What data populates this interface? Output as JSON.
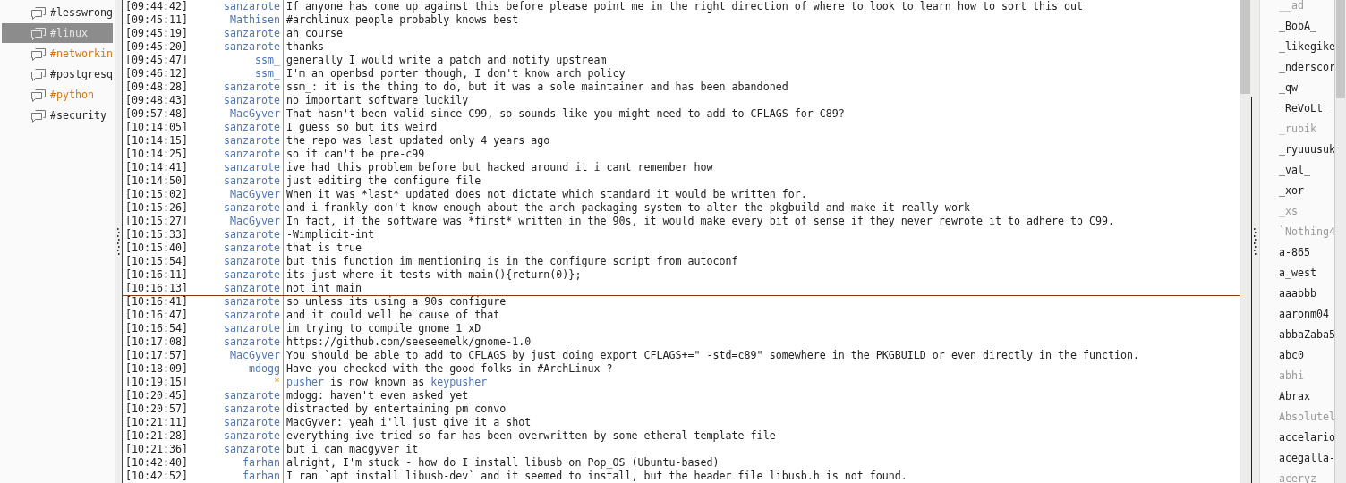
{
  "sidebar": [
    {
      "label": "#lesswrong",
      "selected": false,
      "activity": false
    },
    {
      "label": "#linux",
      "selected": true,
      "activity": false
    },
    {
      "label": "#networkin",
      "selected": false,
      "activity": true
    },
    {
      "label": "#postgresq",
      "selected": false,
      "activity": false
    },
    {
      "label": "#python",
      "selected": false,
      "activity": true
    },
    {
      "label": "#security",
      "selected": false,
      "activity": false
    }
  ],
  "chat": [
    {
      "kind": "message",
      "time": "[09:44:42]",
      "nick": "sanzarote",
      "text": "If anyone has come up against this before please point me in the right direction of where to look to learn how to sort this out",
      "marker": false
    },
    {
      "kind": "message",
      "time": "[09:45:11]",
      "nick": "Mathisen",
      "text": "#archlinux people probably knows best",
      "marker": false
    },
    {
      "kind": "message",
      "time": "[09:45:19]",
      "nick": "sanzarote",
      "text": "ah course",
      "marker": false
    },
    {
      "kind": "message",
      "time": "[09:45:20]",
      "nick": "sanzarote",
      "text": "thanks",
      "marker": false
    },
    {
      "kind": "message",
      "time": "[09:45:47]",
      "nick": "ssm_",
      "text": "generally I would write a patch and notify upstream",
      "marker": false
    },
    {
      "kind": "message",
      "time": "[09:46:12]",
      "nick": "ssm_",
      "text": "I'm an openbsd porter though, I don't know arch policy",
      "marker": false
    },
    {
      "kind": "message",
      "time": "[09:48:28]",
      "nick": "sanzarote",
      "text": "ssm_: it is the thing to do, but it was a sole maintainer and has been abandoned",
      "marker": false
    },
    {
      "kind": "message",
      "time": "[09:48:43]",
      "nick": "sanzarote",
      "text": "no important software luckily",
      "marker": false
    },
    {
      "kind": "message",
      "time": "[09:57:48]",
      "nick": "MacGyver",
      "text": "That hasn't been valid since C99, so sounds like you might need to add to CFLAGS for C89?",
      "marker": false
    },
    {
      "kind": "message",
      "time": "[10:14:05]",
      "nick": "sanzarote",
      "text": "I guess so but its weird",
      "marker": false
    },
    {
      "kind": "message",
      "time": "[10:14:15]",
      "nick": "sanzarote",
      "text": "the repo was last updated only 4 years ago",
      "marker": false
    },
    {
      "kind": "message",
      "time": "[10:14:25]",
      "nick": "sanzarote",
      "text": "so it can't be pre-c99",
      "marker": false
    },
    {
      "kind": "message",
      "time": "[10:14:41]",
      "nick": "sanzarote",
      "text": "ive had this problem before but hacked around it i cant remember how",
      "marker": false
    },
    {
      "kind": "message",
      "time": "[10:14:50]",
      "nick": "sanzarote",
      "text": "just editing the configure file",
      "marker": false
    },
    {
      "kind": "message",
      "time": "[10:15:02]",
      "nick": "MacGyver",
      "text": "When it was *last* updated does not dictate which standard it would be written for.",
      "marker": false
    },
    {
      "kind": "message",
      "time": "[10:15:26]",
      "nick": "sanzarote",
      "text": "and i frankly don't know enough about the arch packaging system to alter the pkgbuild and make it really work",
      "marker": false
    },
    {
      "kind": "message",
      "time": "[10:15:27]",
      "nick": "MacGyver",
      "text": "In fact, if the software was *first* written in the 90s, it would make every bit of sense if they never rewrote it to adhere to C99.",
      "marker": false
    },
    {
      "kind": "message",
      "time": "[10:15:33]",
      "nick": "sanzarote",
      "text": "-Wimplicit-int",
      "marker": false
    },
    {
      "kind": "message",
      "time": "[10:15:40]",
      "nick": "sanzarote",
      "text": "that is true",
      "marker": false
    },
    {
      "kind": "message",
      "time": "[10:15:54]",
      "nick": "sanzarote",
      "text": "but this function im mentioning is in the configure script from autoconf",
      "marker": false
    },
    {
      "kind": "message",
      "time": "[10:16:11]",
      "nick": "sanzarote",
      "text": "its just where it tests with main(){return(0)};",
      "marker": false
    },
    {
      "kind": "message",
      "time": "[10:16:13]",
      "nick": "sanzarote",
      "text": "not int main",
      "marker": false
    },
    {
      "kind": "message",
      "time": "[10:16:41]",
      "nick": "sanzarote",
      "text": "so unless its using a 90s configure",
      "marker": true
    },
    {
      "kind": "message",
      "time": "[10:16:47]",
      "nick": "sanzarote",
      "text": "and it could well be cause of that",
      "marker": false
    },
    {
      "kind": "message",
      "time": "[10:16:54]",
      "nick": "sanzarote",
      "text": "im trying to compile gnome 1 xD",
      "marker": false
    },
    {
      "kind": "message",
      "time": "[10:17:08]",
      "nick": "sanzarote",
      "text": "https://github.com/seeseemelk/gnome-1.0",
      "marker": false
    },
    {
      "kind": "message",
      "time": "[10:17:57]",
      "nick": "MacGyver",
      "text": "You should be able to add to CFLAGS by just doing export CFLAGS+=\" -std=c89\" somewhere in the PKGBUILD or even directly in the function.",
      "marker": false
    },
    {
      "kind": "message",
      "time": "[10:18:09]",
      "nick": "mdogg",
      "text": "Have you checked with the good folks in #ArchLinux ?",
      "marker": false
    },
    {
      "kind": "nick_change",
      "time": "[10:19:15]",
      "nick": "*",
      "old_nick": "pusher",
      "text": "is now known as",
      "new_nick": "keypusher",
      "marker": false
    },
    {
      "kind": "message",
      "time": "[10:20:45]",
      "nick": "sanzarote",
      "text": "mdogg: haven't even asked yet",
      "marker": false
    },
    {
      "kind": "message",
      "time": "[10:20:57]",
      "nick": "sanzarote",
      "text": "distracted by entertaining pm convo",
      "marker": false
    },
    {
      "kind": "message",
      "time": "[10:21:11]",
      "nick": "sanzarote",
      "text": "MacGyver: yeah i'll just give it a shot",
      "marker": false
    },
    {
      "kind": "message",
      "time": "[10:21:28]",
      "nick": "sanzarote",
      "text": "everything ive tried so far has been overwritten by some etheral template file",
      "marker": false
    },
    {
      "kind": "message",
      "time": "[10:21:36]",
      "nick": "sanzarote",
      "text": "but i can macgyver it",
      "marker": false
    },
    {
      "kind": "message",
      "time": "[10:42:40]",
      "nick": "farhan",
      "text": "alright, I'm stuck - how do I install libusb on Pop_OS (Ubuntu-based)",
      "marker": false
    },
    {
      "kind": "message",
      "time": "[10:42:52]",
      "nick": "farhan",
      "text": "I ran `apt install libusb-dev` and it seemed to install, but the header file libusb.h is not found.",
      "marker": false
    }
  ],
  "users": [
    {
      "name": "__ad",
      "away": true
    },
    {
      "name": "_BobA_",
      "away": false
    },
    {
      "name": "_likegike",
      "away": false
    },
    {
      "name": "_nderscor",
      "away": false
    },
    {
      "name": "_qw",
      "away": false
    },
    {
      "name": "_ReVoLt_",
      "away": false
    },
    {
      "name": "_rubik",
      "away": true
    },
    {
      "name": "_ryuuusuk",
      "away": false
    },
    {
      "name": "_val_",
      "away": false
    },
    {
      "name": "_xor",
      "away": false
    },
    {
      "name": "_xs",
      "away": true
    },
    {
      "name": "`Nothing4",
      "away": true
    },
    {
      "name": "a-865",
      "away": false
    },
    {
      "name": "a_west",
      "away": false
    },
    {
      "name": "aaabbb",
      "away": false
    },
    {
      "name": "aaronm04",
      "away": false
    },
    {
      "name": "abbaZaba5",
      "away": false
    },
    {
      "name": "abc0",
      "away": false
    },
    {
      "name": "abhi",
      "away": true
    },
    {
      "name": "Abrax",
      "away": false
    },
    {
      "name": "Absolutel",
      "away": true
    },
    {
      "name": "accelario",
      "away": false
    },
    {
      "name": "acegalla-",
      "away": false
    },
    {
      "name": "aceryz",
      "away": true
    }
  ]
}
